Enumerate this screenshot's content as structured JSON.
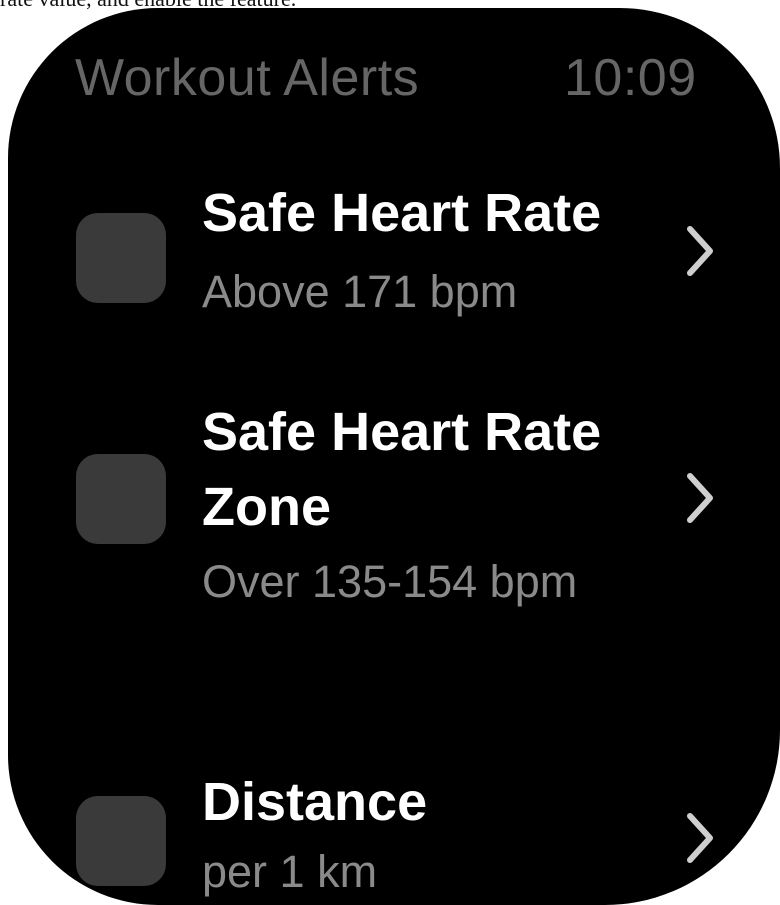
{
  "caption": "rate value, and enable the feature.",
  "header": {
    "title": "Workout Alerts",
    "clock": "10:09"
  },
  "alerts": [
    {
      "title": "Safe Heart Rate",
      "subtitle": "Above 171 bpm",
      "checked": false
    },
    {
      "title": "Safe Heart Rate Zone",
      "subtitle": "Over 135-154 bpm",
      "checked": false
    },
    {
      "title": "Distance",
      "subtitle": "per 1 km",
      "checked": false
    }
  ],
  "colors": {
    "background": "#000000",
    "title_text": "#ffffff",
    "subtitle_text": "#8a8a8a",
    "header_text": "#666666",
    "checkbox_fill": "#3a3a3a",
    "chevron": "#cfcfcf"
  },
  "icons": {
    "item_action": "chevron-right-icon"
  }
}
